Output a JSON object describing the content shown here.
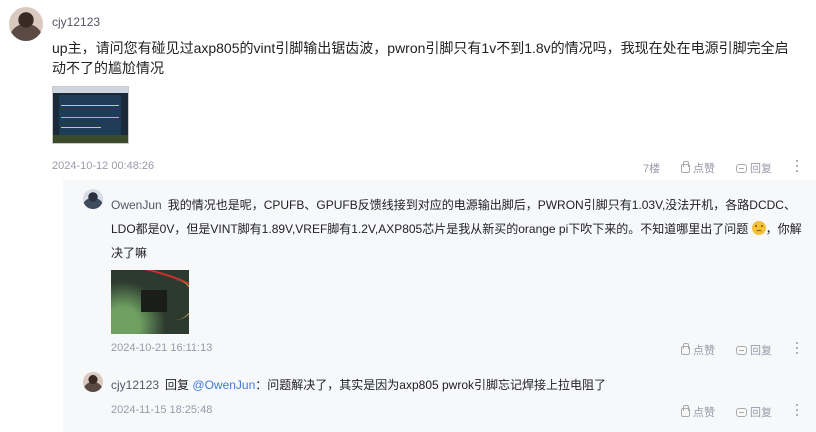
{
  "main_comment": {
    "username": "cjy12123",
    "body": "up主，请问您有碰见过axp805的vint引脚输出锯齿波，pwron引脚只有1v不到1.8v的情况吗，我现在处在电源引脚完全启动不了的尴尬情况",
    "timestamp": "2024-10-12 00:48:26",
    "floor": "7楼",
    "like_label": "点赞",
    "reply_label": "回复"
  },
  "replies": [
    {
      "username": "OwenJun",
      "body": "我的情况也是呢，CPUFB、GPUFB反馈线接到对应的电源输出脚后，PWRON引脚只有1.03V,没法开机，各路DCDC、LDO都是0V，但是VINT脚有1.89V,VREF脚有1.2V,AXP805芯片是我从新买的orange pi下吹下来的。不知道哪里出了问题",
      "body_after_emoji": "，你解决了嘛",
      "timestamp": "2024-10-21 16:11:13",
      "like_label": "点赞",
      "reply_label": "回复"
    },
    {
      "username": "cjy12123",
      "reply_word": "回复",
      "mention": "@OwenJun",
      "body": "：问题解决了，其实是因为axp805 pwrok引脚忘记焊接上拉电阻了",
      "timestamp": "2024-11-15 18:25:48",
      "like_label": "点赞",
      "reply_label": "回复"
    }
  ],
  "colors": {
    "text": "#222226",
    "meta": "#999aaa",
    "mention": "#3e7bd8",
    "reply_bg": "#f7f8fa"
  }
}
